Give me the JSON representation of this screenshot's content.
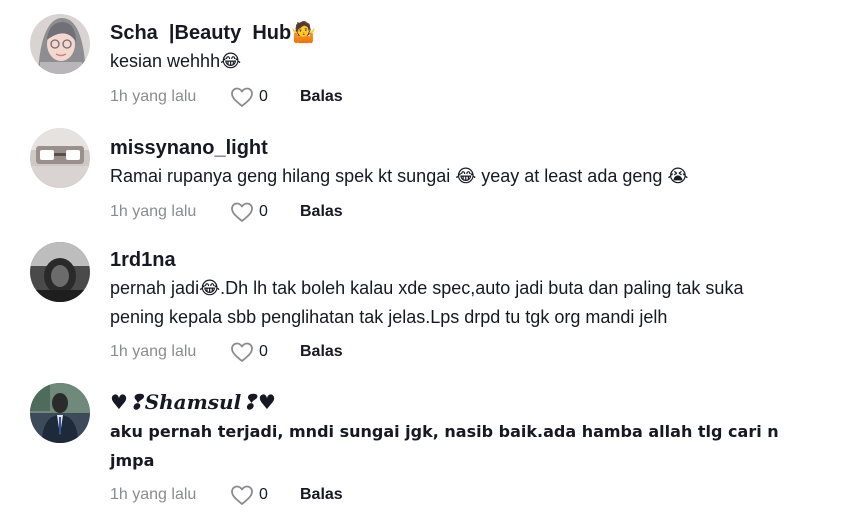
{
  "comments": [
    {
      "username": "Scha  |Beauty  Hub",
      "username_emoji": "🤷",
      "text": "kesian wehhh😂",
      "time": "1h yang lalu",
      "likes": "0",
      "reply": "Balas"
    },
    {
      "username": "missynano_light",
      "text": "Ramai rupanya geng hilang spek kt sungai 😂  yeay at least ada geng 😭",
      "time": "1h yang lalu",
      "likes": "0",
      "reply": "Balas"
    },
    {
      "username": "1rd1na",
      "text": "pernah jadi😂.Dh lh tak boleh kalau xde spec,auto jadi buta dan paling tak suka pening kepala sbb penglihatan tak jelas.Lps drpd tu tgk org mandi jelh",
      "time": "1h yang lalu",
      "likes": "0",
      "reply": "Balas"
    },
    {
      "username": "♥❢Shamsul❢♥",
      "text": "aku pernah terjadi, mndi sungai jgk, nasib baik.ada hamba allah tlg cari n jmpa",
      "time": "1h yang lalu",
      "likes": "0",
      "reply": "Balas"
    }
  ],
  "icons": {
    "like": "heart-outline-icon"
  },
  "colors": {
    "timestamp": "#8a8b91",
    "text": "#161823"
  }
}
